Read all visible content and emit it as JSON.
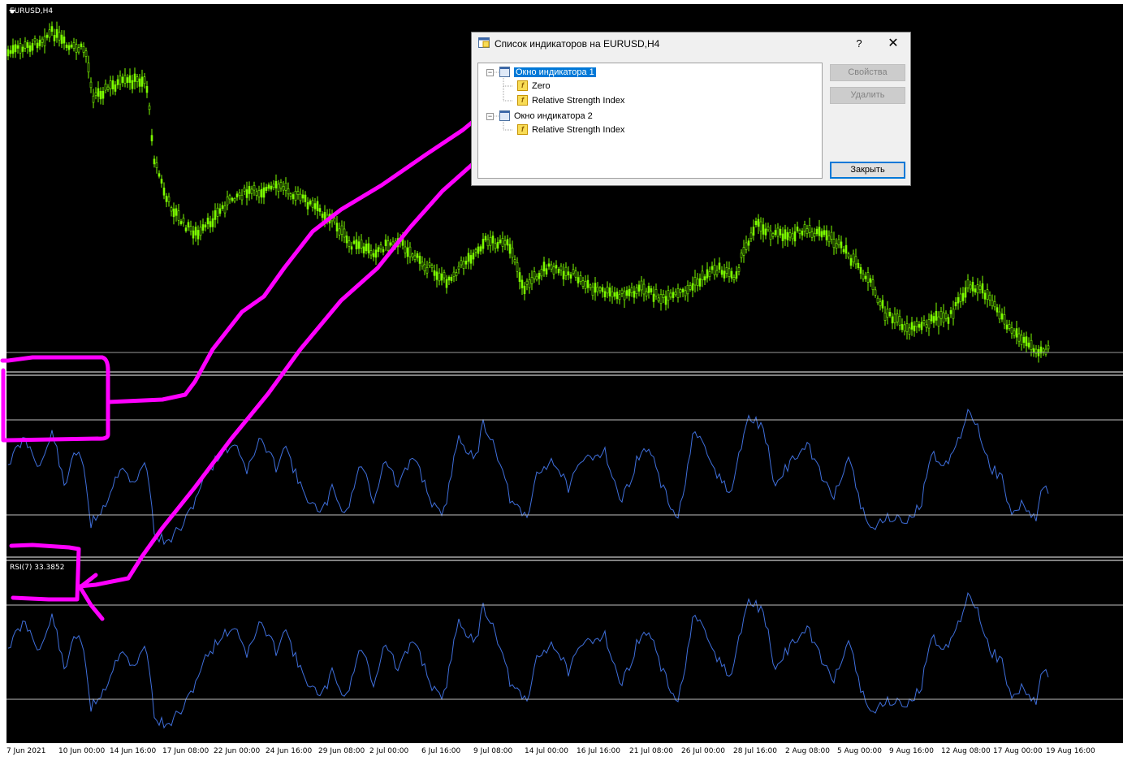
{
  "chart": {
    "symbol": "EURUSD,H4",
    "rsi_label": "RSI(7) 33.3852",
    "colors": {
      "background": "#000000",
      "price_candles": "#7CFC00",
      "rsi_line": "#3f6fdc",
      "levels": "#c0c0c0",
      "annotation": "#ff00ff"
    },
    "x_axis_labels": [
      "7 Jun 2021",
      "10 Jun 00:00",
      "14 Jun 16:00",
      "17 Jun 08:00",
      "22 Jun 00:00",
      "24 Jun 16:00",
      "29 Jun 08:00",
      "2 Jul 00:00",
      "6 Jul 16:00",
      "9 Jul 08:00",
      "14 Jul 00:00",
      "16 Jul 16:00",
      "21 Jul 08:00",
      "26 Jul 00:00",
      "28 Jul 16:00",
      "2 Aug 08:00",
      "5 Aug 00:00",
      "9 Aug 16:00",
      "12 Aug 08:00",
      "17 Aug 00:00",
      "19 Aug 16:00"
    ]
  },
  "dialog": {
    "title": "Список индикаторов на EURUSD,H4",
    "help_label": "?",
    "close_label": "✕",
    "buttons": {
      "properties": "Свойства",
      "delete": "Удалить",
      "close": "Закрыть"
    },
    "tree": [
      {
        "label": "Окно индикатора 1",
        "icon": "indicator-window-icon",
        "selected": true
      },
      {
        "label": "Zero",
        "icon": "function-icon"
      },
      {
        "label": "Relative Strength Index",
        "icon": "function-icon"
      },
      {
        "label": "Окно индикатора 2",
        "icon": "indicator-window-icon"
      },
      {
        "label": "Relative Strength Index",
        "icon": "function-icon"
      }
    ]
  }
}
